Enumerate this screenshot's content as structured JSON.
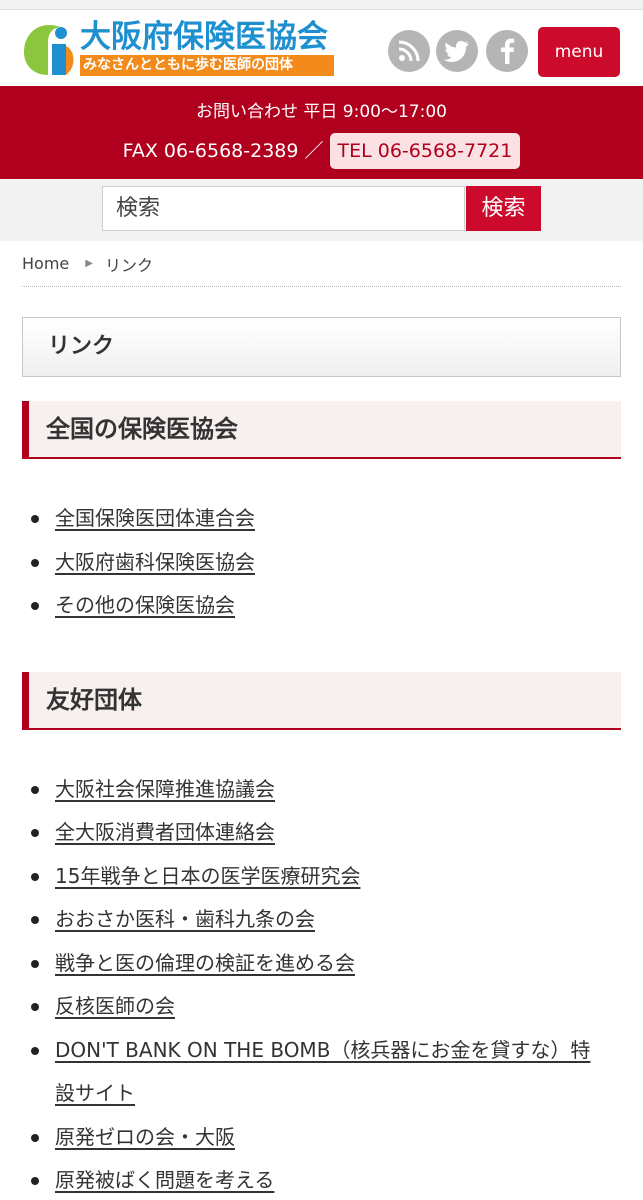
{
  "header": {
    "logo_title": "大阪府保険医協会",
    "logo_subtitle": "みなさんとともに歩む医師の団体",
    "social_icons": [
      "rss-icon",
      "twitter-icon",
      "facebook-icon"
    ],
    "menu_label": "menu"
  },
  "contact": {
    "hours": "お問い合わせ 平日 9:00〜17:00",
    "fax": "FAX 06-6568-2389",
    "separator": "／",
    "tel": "TEL 06-6568-7721"
  },
  "search": {
    "placeholder": "検索",
    "button_label": "検索"
  },
  "breadcrumb": {
    "home": "Home",
    "current": "リンク"
  },
  "page_title": "リンク",
  "sections": [
    {
      "heading": "全国の保険医協会",
      "links": [
        "全国保険医団体連合会",
        "大阪府歯科保険医協会",
        "その他の保険医協会"
      ]
    },
    {
      "heading": "友好団体",
      "links": [
        "大阪社会保障推進協議会",
        "全大阪消費者団体連絡会",
        "15年戦争と日本の医学医療研究会",
        "おおさか医科・歯科九条の会",
        "戦争と医の倫理の検証を進める会",
        "反核医師の会",
        "DON'T BANK ON THE BOMB（核兵器にお金を貸すな）特設サイト",
        "原発ゼロの会・大阪",
        "原発被ばく問題を考える"
      ]
    }
  ],
  "colors": {
    "brand_red": "#b0001e",
    "button_red": "#cc0a2b",
    "logo_blue": "#1e90d0",
    "logo_orange": "#f28a1c"
  }
}
